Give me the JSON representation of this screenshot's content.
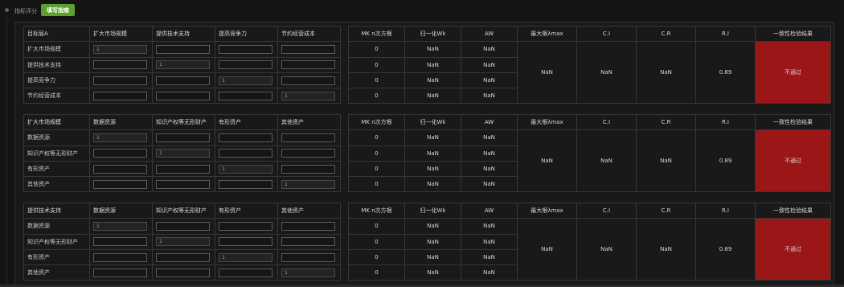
{
  "header": {
    "title": "指标评分",
    "guide_button": "填写指南"
  },
  "right_headers": [
    "MK n次方根",
    "归一化Wk",
    "AW",
    "最大根λmax",
    "C.I",
    "C.R",
    "R.I",
    "一致性检验结果"
  ],
  "blocks": [
    {
      "header": [
        "目标层A",
        "扩大市场规模",
        "提供技术支持",
        "提高竞争力",
        "节约经营成本"
      ],
      "rows": [
        {
          "label": "扩大市场规模",
          "inputs": [
            "1",
            "",
            "",
            ""
          ],
          "mk": "0",
          "wk": "NaN",
          "aw": "NaN"
        },
        {
          "label": "提供技术支持",
          "inputs": [
            "",
            "1",
            "",
            ""
          ],
          "mk": "0",
          "wk": "NaN",
          "aw": "NaN"
        },
        {
          "label": "提高竞争力",
          "inputs": [
            "",
            "",
            "1",
            ""
          ],
          "mk": "0",
          "wk": "NaN",
          "aw": "NaN"
        },
        {
          "label": "节约经营成本",
          "inputs": [
            "",
            "",
            "",
            "1"
          ],
          "mk": "0",
          "wk": "NaN",
          "aw": "NaN"
        }
      ],
      "lambda_max": "NaN",
      "ci": "NaN",
      "cr": "NaN",
      "ri": "0.89",
      "result": "不通过"
    },
    {
      "header": [
        "扩大市场规模",
        "数据资源",
        "知识产权等无形财产",
        "有形资产",
        "其他资产"
      ],
      "rows": [
        {
          "label": "数据资源",
          "inputs": [
            "1",
            "",
            "",
            ""
          ],
          "mk": "0",
          "wk": "NaN",
          "aw": "NaN"
        },
        {
          "label": "知识产权等无形财产",
          "inputs": [
            "",
            "1",
            "",
            ""
          ],
          "mk": "0",
          "wk": "NaN",
          "aw": "NaN"
        },
        {
          "label": "有形资产",
          "inputs": [
            "",
            "",
            "1",
            ""
          ],
          "mk": "0",
          "wk": "NaN",
          "aw": "NaN"
        },
        {
          "label": "其他资产",
          "inputs": [
            "",
            "",
            "",
            "1"
          ],
          "mk": "0",
          "wk": "NaN",
          "aw": "NaN"
        }
      ],
      "lambda_max": "NaN",
      "ci": "NaN",
      "cr": "NaN",
      "ri": "0.89",
      "result": "不通过"
    },
    {
      "header": [
        "提供技术支持",
        "数据资源",
        "知识产权等无形财产",
        "有形资产",
        "其他资产"
      ],
      "rows": [
        {
          "label": "数据资源",
          "inputs": [
            "1",
            "",
            "",
            ""
          ],
          "mk": "0",
          "wk": "NaN",
          "aw": "NaN"
        },
        {
          "label": "知识产权等无形财产",
          "inputs": [
            "",
            "1",
            "",
            ""
          ],
          "mk": "0",
          "wk": "NaN",
          "aw": "NaN"
        },
        {
          "label": "有形资产",
          "inputs": [
            "",
            "",
            "1",
            ""
          ],
          "mk": "0",
          "wk": "NaN",
          "aw": "NaN"
        },
        {
          "label": "其他资产",
          "inputs": [
            "",
            "",
            "",
            "1"
          ],
          "mk": "0",
          "wk": "NaN",
          "aw": "NaN"
        }
      ],
      "lambda_max": "NaN",
      "ci": "NaN",
      "cr": "NaN",
      "ri": "0.89",
      "result": "不通过"
    }
  ]
}
